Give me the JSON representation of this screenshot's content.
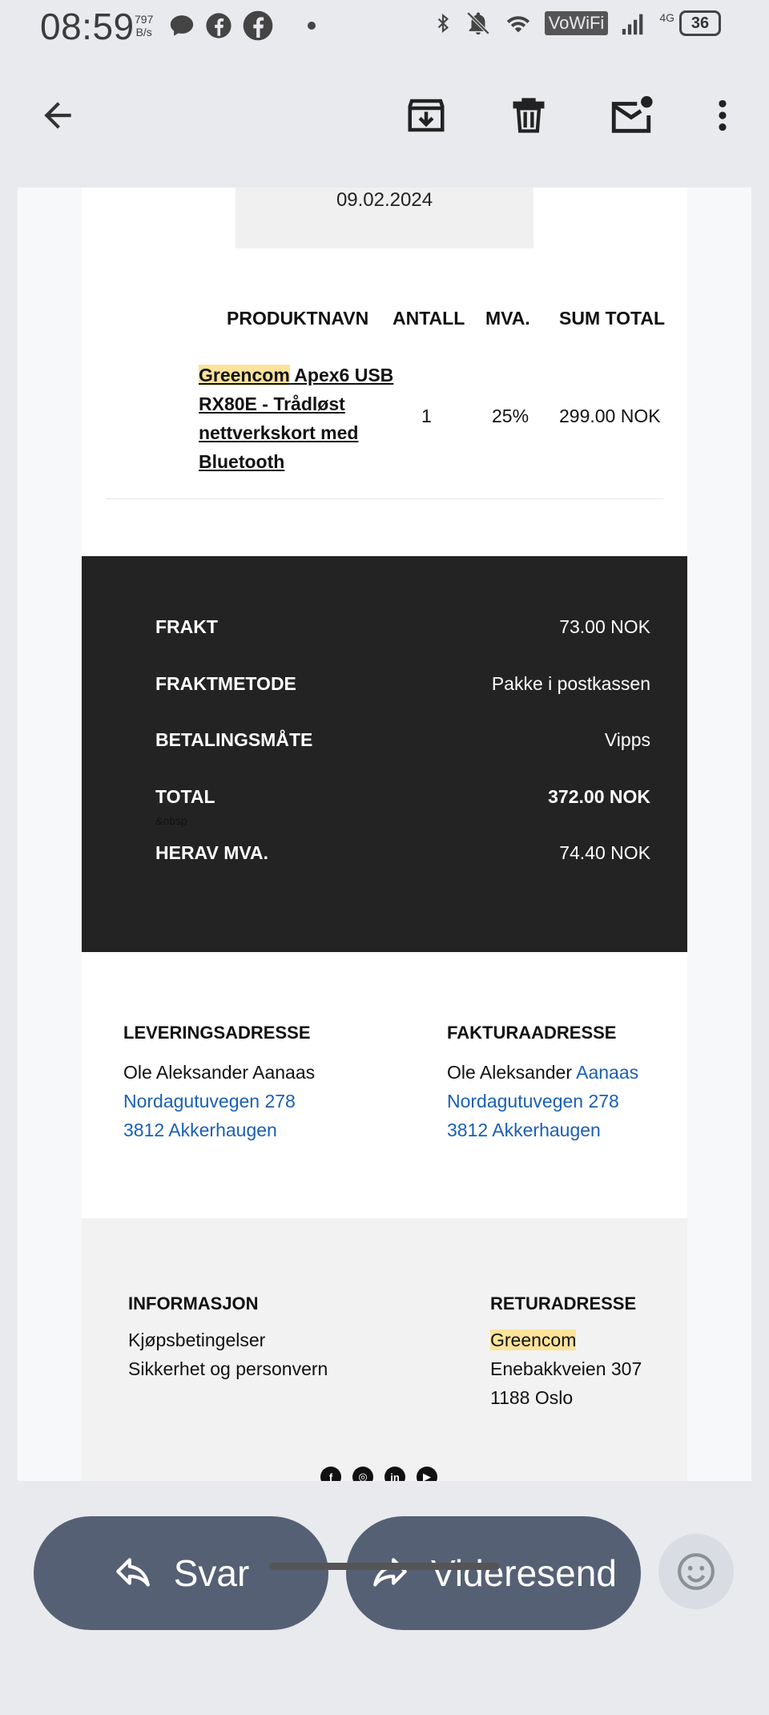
{
  "status_bar": {
    "time": "08:59",
    "net_speed_value": "797",
    "net_speed_unit": "B/s",
    "network_label": "VoWiFi",
    "lte_label": "4G",
    "battery": "36"
  },
  "email": {
    "date": "09.02.2024",
    "product_table": {
      "headers": [
        "PRODUKTNAVN",
        "ANTALL",
        "MVA.",
        "SUM TOTAL"
      ],
      "row": {
        "brand": "Greencom",
        "name_rest": " Apex6 USB RX80E - Trådløst nettverkskort med Bluetooth",
        "quantity": "1",
        "vat": "25%",
        "sum": "299.00 NOK"
      }
    },
    "summary": {
      "rows": [
        {
          "label": "FRAKT",
          "value": "73.00 NOK"
        },
        {
          "label": "FRAKTMETODE",
          "value": "Pakke i postkassen"
        },
        {
          "label": "BETALINGSMÅTE",
          "value": "Vipps"
        },
        {
          "label": "TOTAL",
          "value": "372.00 NOK"
        },
        {
          "label": "HERAV MVA.",
          "value": "74.40 NOK"
        }
      ],
      "nbsp_text": "&nbsp"
    },
    "delivery_address": {
      "heading": "LEVERINGSADRESSE",
      "name": "Ole Aleksander Aanaas",
      "street": "Nordagutuvegen 278",
      "city": "3812 Akkerhaugen"
    },
    "billing_address": {
      "heading": "FAKTURAADRESSE",
      "first_name": "Ole Aleksander",
      "last_name": "Aanaas",
      "street": "Nordagutuvegen 278",
      "city": "3812 Akkerhaugen"
    },
    "information": {
      "heading": "INFORMASJON",
      "links": [
        "Kjøpsbetingelser",
        "Sikkerhet og personvern"
      ]
    },
    "return_address": {
      "heading": "RETURADRESSE",
      "name": "Greencom",
      "street": "Enebakkveien 307",
      "city": "1188 Oslo"
    }
  },
  "actions": {
    "reply": "Svar",
    "forward": "Videresend"
  },
  "colors": {
    "accent_link": "#1a5fb4",
    "highlight": "#fbe39a",
    "dark_panel": "#232323",
    "action_pill": "#566074"
  }
}
